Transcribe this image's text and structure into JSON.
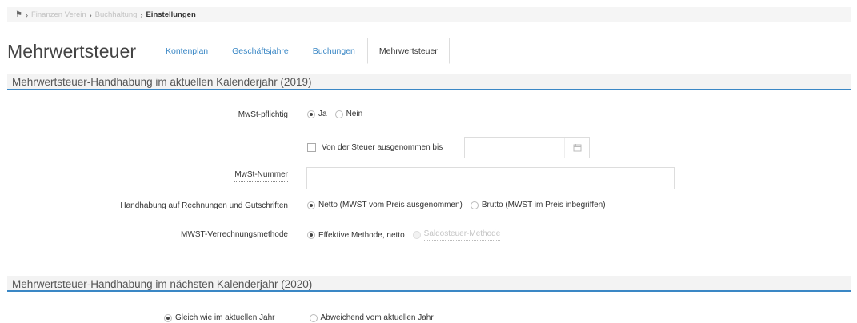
{
  "breadcrumb": {
    "home_icon": "home-icon",
    "items": [
      "Finanzen Verein",
      "Buchhaltung"
    ],
    "current": "Einstellungen"
  },
  "page": {
    "title": "Mehrwertsteuer"
  },
  "tabs": [
    {
      "label": "Kontenplan",
      "active": false
    },
    {
      "label": "Geschäftsjahre",
      "active": false
    },
    {
      "label": "Buchungen",
      "active": false
    },
    {
      "label": "Mehrwertsteuer",
      "active": true
    }
  ],
  "current_year": {
    "header": "Mehrwertsteuer-Handhabung im aktuellen Kalenderjahr (2019)",
    "vat_liable": {
      "label": "MwSt-pflichtig",
      "options": [
        {
          "label": "Ja",
          "checked": true
        },
        {
          "label": "Nein",
          "checked": false
        }
      ]
    },
    "exempt": {
      "label": "Von der Steuer ausgenommen bis",
      "checked": false,
      "date_value": "",
      "calendar_icon": "calendar-icon"
    },
    "vat_number": {
      "label": "MwSt-Nummer",
      "value": ""
    },
    "invoice_handling": {
      "label": "Handhabung auf Rechnungen und Gutschriften",
      "options": [
        {
          "label": "Netto (MWST vom Preis ausgenommen)",
          "checked": true
        },
        {
          "label": "Brutto (MWST im Preis inbegriffen)",
          "checked": false
        }
      ]
    },
    "method": {
      "label": "MWST-Verrechnungsmethode",
      "options": [
        {
          "label": "Effektive Methode, netto",
          "checked": true,
          "disabled": false
        },
        {
          "label": "Saldosteuer-Methode",
          "checked": false,
          "disabled": true
        }
      ]
    }
  },
  "next_year": {
    "header": "Mehrwertsteuer-Handhabung im nächsten Kalenderjahr (2020)",
    "options": [
      {
        "label": "Gleich wie im aktuellen Jahr",
        "checked": true
      },
      {
        "label": "Abweichend vom aktuellen Jahr",
        "checked": false
      }
    ]
  },
  "colors": {
    "accent": "#3a87c5",
    "header_bg": "#f3f3f3",
    "breadcrumb_bg": "#f5f5f5"
  }
}
